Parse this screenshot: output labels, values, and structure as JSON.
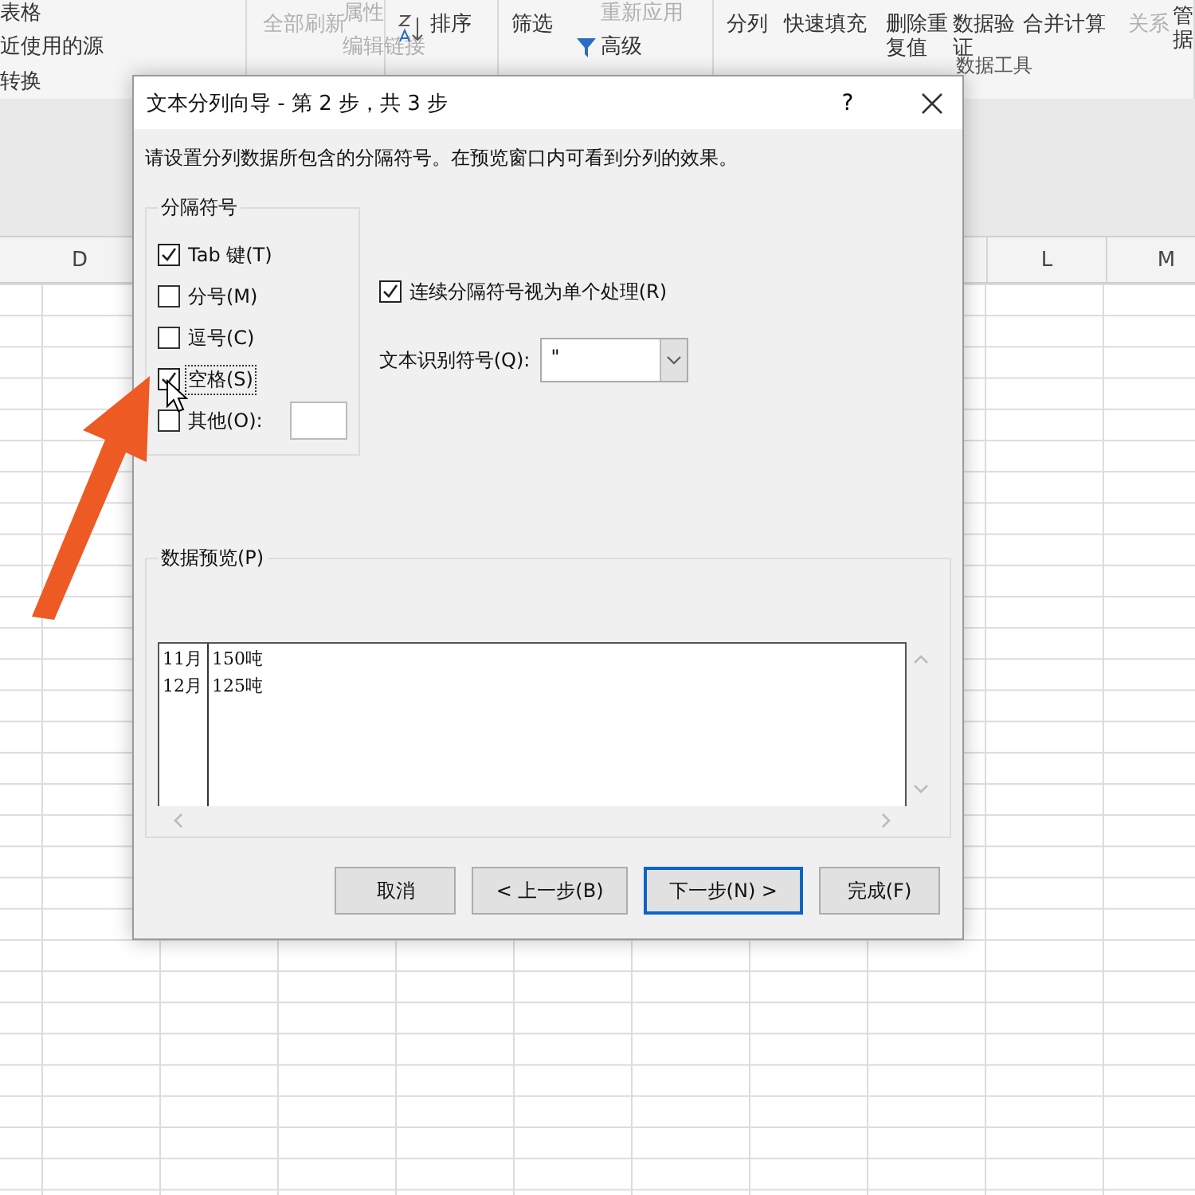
{
  "ribbon": {
    "sections": [
      {
        "items": [
          {
            "label": "表格",
            "disabled": false
          },
          {
            "label": "近使用的源",
            "disabled": false
          },
          {
            "label": "转换",
            "disabled": false
          }
        ]
      },
      {
        "items": [
          {
            "label": "全部刷新",
            "disabled": true
          },
          {
            "label": "属性",
            "disabled": true
          },
          {
            "label": "编辑链接",
            "disabled": true
          }
        ]
      },
      {
        "items": [
          {
            "label": "排序",
            "disabled": false
          }
        ]
      },
      {
        "items": [
          {
            "label": "筛选",
            "disabled": false
          },
          {
            "label": "重新应用",
            "disabled": true
          },
          {
            "label": "高级",
            "disabled": false
          }
        ]
      },
      {
        "items": [
          {
            "label": "分列",
            "disabled": false
          },
          {
            "label": "快速填充",
            "disabled": false
          },
          {
            "label": "删除重复值",
            "disabled": false
          },
          {
            "label": "数据验证",
            "disabled": false
          },
          {
            "label": "合并计算",
            "disabled": false
          },
          {
            "label": "关系",
            "disabled": true
          },
          {
            "label": "管据",
            "disabled": false
          }
        ]
      }
    ],
    "group_label": "数据工具"
  },
  "sheet": {
    "columns": [
      "D",
      "L",
      "M"
    ]
  },
  "dialog": {
    "title": "文本分列向导 - 第 2 步，共 3 步",
    "help": "?",
    "instruction": "请设置分列数据所包含的分隔符号。在预览窗口内可看到分列的效果。",
    "delimiters": {
      "legend": "分隔符号",
      "options": [
        {
          "label": "Tab 键(T)",
          "checked": true,
          "focused": false
        },
        {
          "label": "分号(M)",
          "checked": false,
          "focused": false
        },
        {
          "label": "逗号(C)",
          "checked": false,
          "focused": false
        },
        {
          "label": "空格(S)",
          "checked": true,
          "focused": true
        },
        {
          "label": "其他(O):",
          "checked": false,
          "focused": false
        }
      ]
    },
    "consecutive": {
      "label": "连续分隔符号视为单个处理(R)",
      "checked": true
    },
    "qualifier": {
      "label": "文本识别符号(Q):",
      "value": "\""
    },
    "preview": {
      "legend": "数据预览(P)",
      "rows": [
        [
          "11月",
          "150吨"
        ],
        [
          "12月",
          "125吨"
        ]
      ]
    },
    "buttons": [
      {
        "label": "取消",
        "default": false
      },
      {
        "label": "< 上一步(B)",
        "default": false
      },
      {
        "label": "下一步(N) >",
        "default": true
      },
      {
        "label": "完成(F)",
        "default": false
      }
    ]
  }
}
